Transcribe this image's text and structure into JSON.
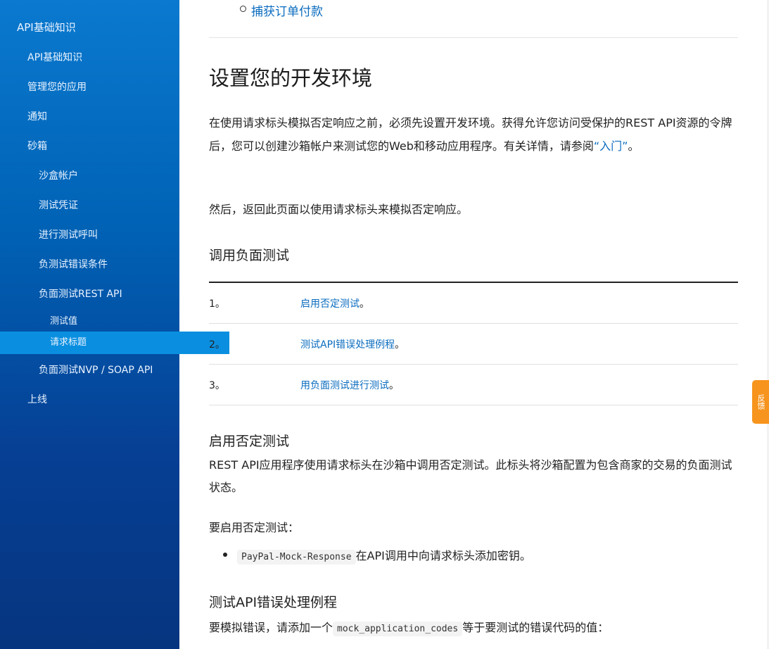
{
  "sidebar": {
    "items": [
      {
        "label": "API基础知识"
      },
      {
        "label": "API基础知识"
      },
      {
        "label": "管理您的应用"
      },
      {
        "label": "通知"
      },
      {
        "label": "砂箱"
      },
      {
        "label": "沙盒帐户"
      },
      {
        "label": "测试凭证"
      },
      {
        "label": "进行测试呼叫"
      },
      {
        "label": "负测试错误条件"
      },
      {
        "label": "负面测试REST API"
      },
      {
        "label": "测试值"
      },
      {
        "label": "请求标题"
      },
      {
        "label": "负面测试NVP / SOAP API"
      },
      {
        "label": "上线"
      }
    ]
  },
  "feedback": {
    "label": "反馈"
  },
  "content": {
    "top_link": "捕获订单付款",
    "section_title": "设置您的开发环境",
    "intro_part1": "在使用请求标头模拟否定响应之前，必须先设置开发环境。获得允许您访问受保护的REST API资源的令牌后，您可以创建沙箱帐户来测试您的Web和移动应用程序。有关详情，请参阅",
    "intro_link": "“入门”",
    "intro_end": "。",
    "then_text": "然后，返回此页面以使用请求标头来模拟否定响应。",
    "invoke_title": "调用负面测试",
    "steps": [
      {
        "num": "1。",
        "link": "启用否定测试",
        "suffix": "。"
      },
      {
        "num": "2。",
        "link": "测试API错误处理例程",
        "suffix": "。"
      },
      {
        "num": "3。",
        "link": "用负面测试进行测试",
        "suffix": "。"
      }
    ],
    "enable_title": "启用否定测试",
    "enable_desc": "REST API应用程序使用请求标头在沙箱中调用否定测试。此标头将沙箱配置为包含商家的交易的负面测试状态。",
    "enable_prompt": "要启用否定测试：",
    "bullet_code": "PayPal-Mock-Response",
    "bullet_text": "在API调用中向请求标头添加密钥。",
    "routine_title": "测试API错误处理例程",
    "routine_text1": "要模拟错误，请添加一个",
    "routine_code": "mock_application_codes",
    "routine_text2": "等于要测试的错误代码的值："
  }
}
